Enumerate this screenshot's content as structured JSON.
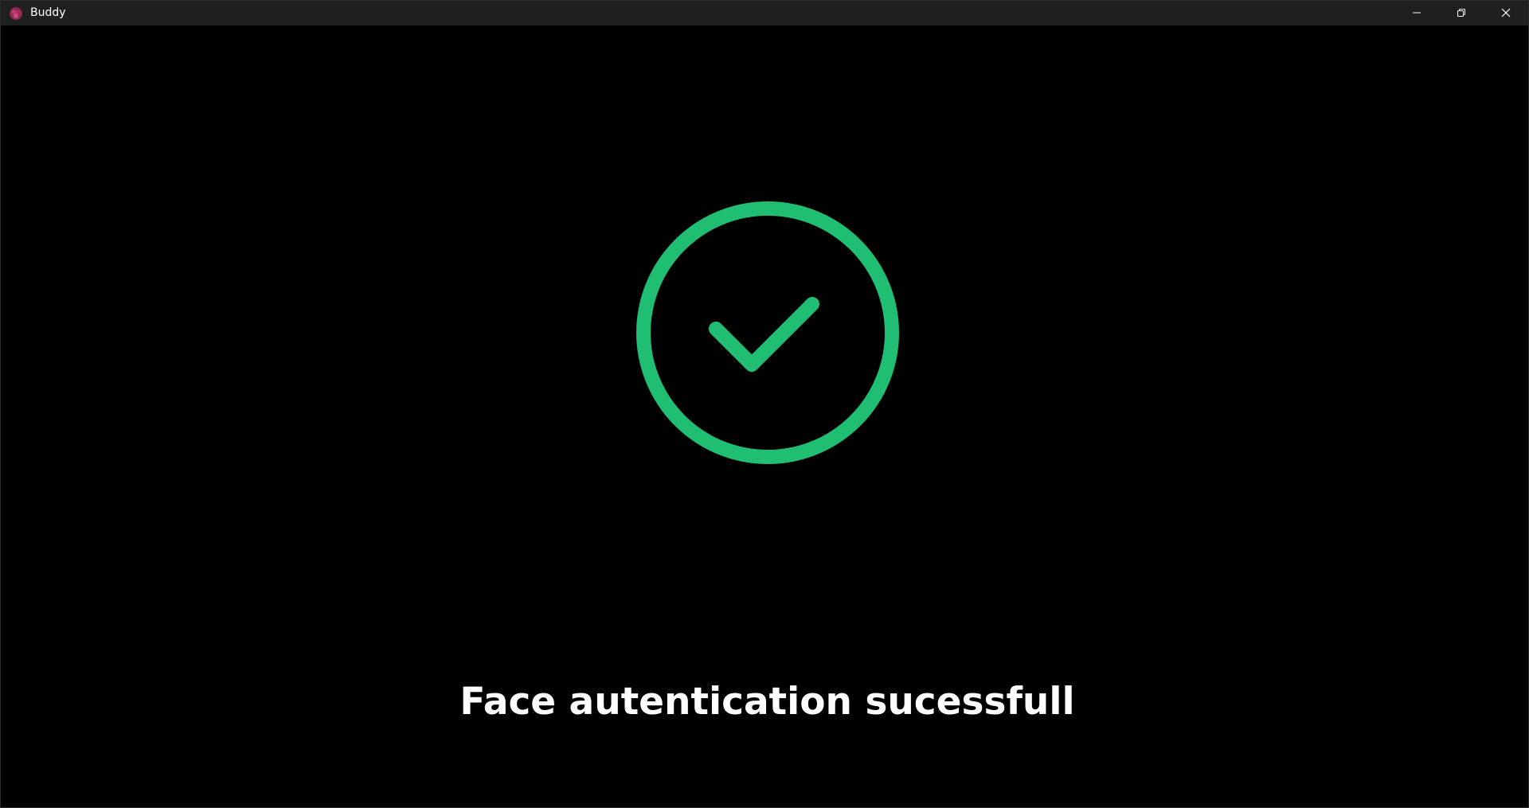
{
  "window": {
    "title": "Buddy",
    "app_icon": "buddy-logo-icon",
    "controls": {
      "minimize_icon": "minimize-icon",
      "restore_icon": "restore-icon",
      "close_icon": "close-icon"
    }
  },
  "main": {
    "status_icon": "check-circle-icon",
    "message": "Face autentication sucessfull"
  },
  "colors": {
    "background": "#000000",
    "titlebar": "#1f1f1f",
    "success": "#1fbe72",
    "text": "#ffffff"
  }
}
